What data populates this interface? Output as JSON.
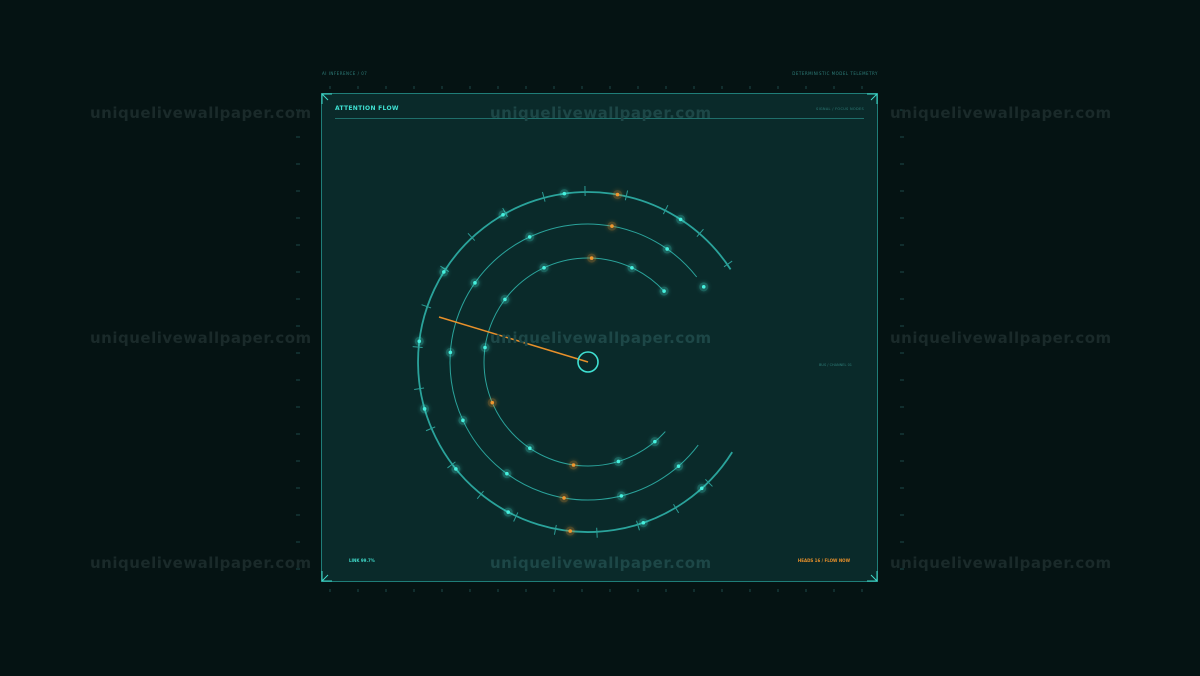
{
  "header": {
    "left": "AI INFERENCE / 07",
    "right": "DETERMINISTIC MODEL TELEMETRY"
  },
  "panel": {
    "title": "ATTENTION FLOW",
    "subtitle": "SIGNAL / FOCUS NODES",
    "side_label": "BUS / CHANNEL 01",
    "footer_left": "LINK 99.7%",
    "footer_right": "HEADS 16 / FLOW NOW"
  },
  "watermark": {
    "text": "uniquelivewallpaper.com"
  },
  "colors": {
    "accent": "#3fe0d2",
    "warm": "#e8902a",
    "panel": "#0a2a2a",
    "background": "#051313"
  }
}
